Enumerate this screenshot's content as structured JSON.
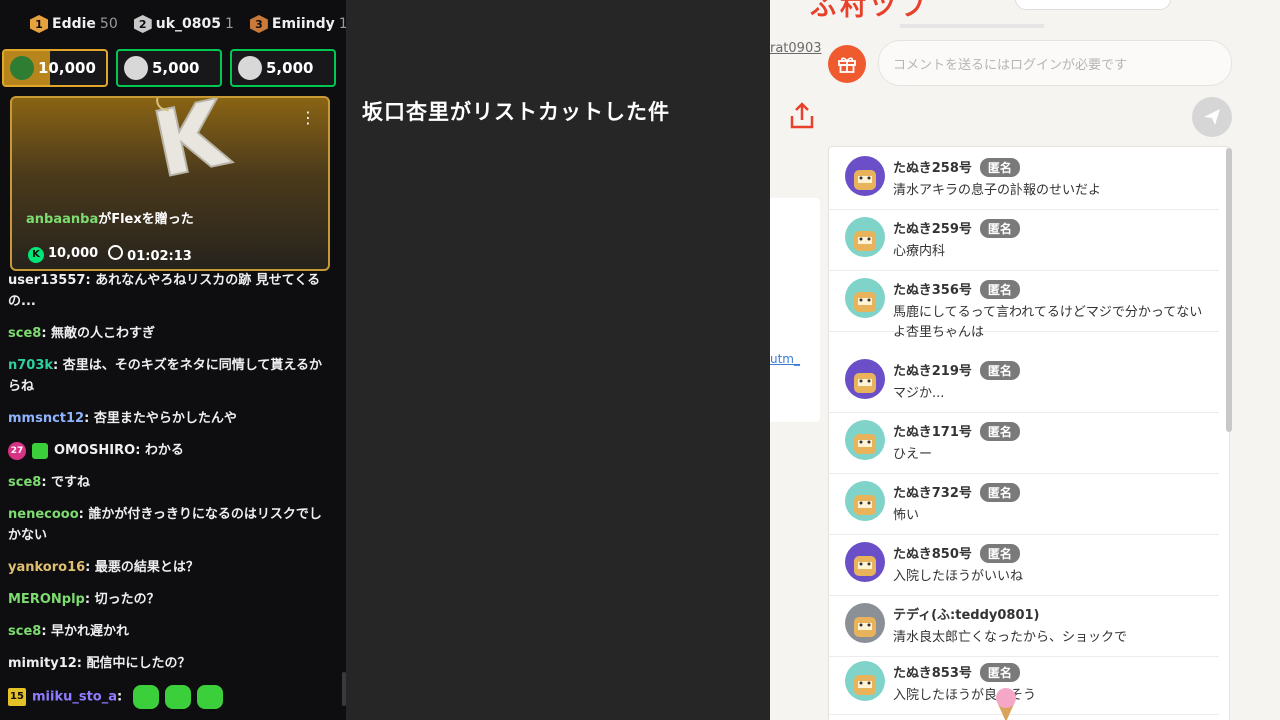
{
  "leaderboard": [
    {
      "rank": "1",
      "name": "Eddie",
      "count": "50",
      "color": "#e6a23c"
    },
    {
      "rank": "2",
      "name": "uk_0805",
      "count": "1",
      "color": "#c8c8c8"
    },
    {
      "rank": "3",
      "name": "Emiindy",
      "count": "1",
      "color": "#c97a3a"
    }
  ],
  "gift_tiles": [
    {
      "value": "10,000",
      "color": "#e0a72b"
    },
    {
      "value": "5,000",
      "color": "#00c853"
    },
    {
      "value": "5,000",
      "color": "#00c853"
    }
  ],
  "gift_card": {
    "user": "anbaanba",
    "text": "がFlexを贈った",
    "coins": "10,000",
    "time": "01:02:13"
  },
  "chat": [
    {
      "user": "user13557",
      "color": "#efeff1",
      "text": "あれなんやろねリスカの跡 見せてくるの..."
    },
    {
      "user": "sce8",
      "color": "#7ddc6f",
      "text": "無敵の人こわすぎ"
    },
    {
      "user": "n703k",
      "color": "#2fd0a0",
      "text": "杏里は、そのキズをネタに同情して貰えるからね"
    },
    {
      "user": "mmsnct12",
      "color": "#8fb4ff",
      "text": "杏里またやらかしたんや"
    },
    {
      "user": "OMOSHIRO",
      "color": "#efeff1",
      "text": "わかる",
      "badge": "27",
      "badge2": true
    },
    {
      "user": "sce8",
      "color": "#7ddc6f",
      "text": "ですね"
    },
    {
      "user": "nenecooo",
      "color": "#7ddc6f",
      "text": "誰かが付きっきりになるのはリスクでしかない"
    },
    {
      "user": "yankoro16",
      "color": "#e0c070",
      "text": "最悪の結果とは？"
    },
    {
      "user": "MERONplp",
      "color": "#7ddc6f",
      "text": "切ったの？"
    },
    {
      "user": "sce8",
      "color": "#7ddc6f",
      "text": "早かれ遅かれ"
    },
    {
      "user": "mimity12",
      "color": "#efeff1",
      "text": "配信中にしたの？"
    },
    {
      "user": "miiku_sto_a",
      "color": "#8f7dff",
      "text": "",
      "badge_sq": "15",
      "emotes": 3
    }
  ],
  "headline": "坂口杏里がリストカットした件",
  "right": {
    "logo": "ふ村ツブ",
    "rat_link": "rat0903",
    "comment_placeholder": "コメントを送るにはログインが必要です",
    "side_link": "utm_",
    "anon_label": "匿名",
    "comments": [
      {
        "name": "たぬき258号",
        "anon": true,
        "text": "清水アキラの息子の訃報のせいだよ",
        "av": "#6a4fc9"
      },
      {
        "name": "たぬき259号",
        "anon": true,
        "text": "心療内科",
        "av": "#7fd3c8"
      },
      {
        "name": "たぬき356号",
        "anon": true,
        "text": "馬鹿にしてるって言われてるけどマジで分かってないよ杏里ちゃんは",
        "av": "#7fd3c8"
      },
      {
        "name": "たぬき219号",
        "anon": true,
        "text": "マジか...",
        "av": "#6a4fc9"
      },
      {
        "name": "たぬき171号",
        "anon": true,
        "text": "ひえー",
        "av": "#7fd3c8"
      },
      {
        "name": "たぬき732号",
        "anon": true,
        "text": "怖い",
        "av": "#7fd3c8"
      },
      {
        "name": "たぬき850号",
        "anon": true,
        "text": "入院したほうがいいね",
        "av": "#6a4fc9"
      },
      {
        "name": "テディ(ふ:teddy0801)",
        "anon": false,
        "text": "清水良太郎亡くなったから、ショックで",
        "av": "#8a9096"
      },
      {
        "name": "たぬき853号",
        "anon": true,
        "text": "入院したほうが良さそう",
        "av": "#7fd3c8"
      }
    ]
  }
}
